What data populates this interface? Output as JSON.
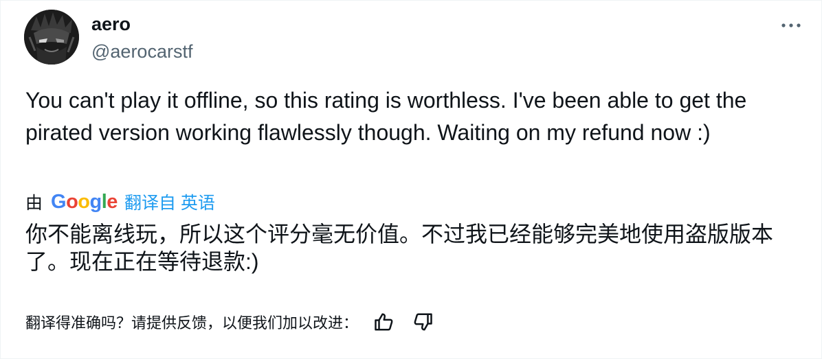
{
  "author": {
    "display_name": "aero",
    "handle": "@aerocarstf",
    "avatar_icon": "avatar-image"
  },
  "menu": {
    "more_icon": "more-horizontal-icon"
  },
  "tweet": {
    "text": "You can't play it offline, so this rating is worthless. I've been able to get the pirated version working flawlessly though. Waiting on my refund now :)"
  },
  "translation": {
    "by_label": "由",
    "provider": "Google",
    "source_label": "翻译自 英语",
    "text": "你不能离线玩，所以这个评分毫无价值。不过我已经能够完美地使用盗版版本了。现在正在等待退款:)"
  },
  "feedback": {
    "prompt": "翻译得准确吗？请提供反馈，以便我们加以改进：",
    "thumbs_up_icon": "thumbs-up-icon",
    "thumbs_down_icon": "thumbs-down-icon"
  },
  "colors": {
    "text_primary": "#0f1419",
    "text_secondary": "#536471",
    "link": "#1d9bf0"
  }
}
